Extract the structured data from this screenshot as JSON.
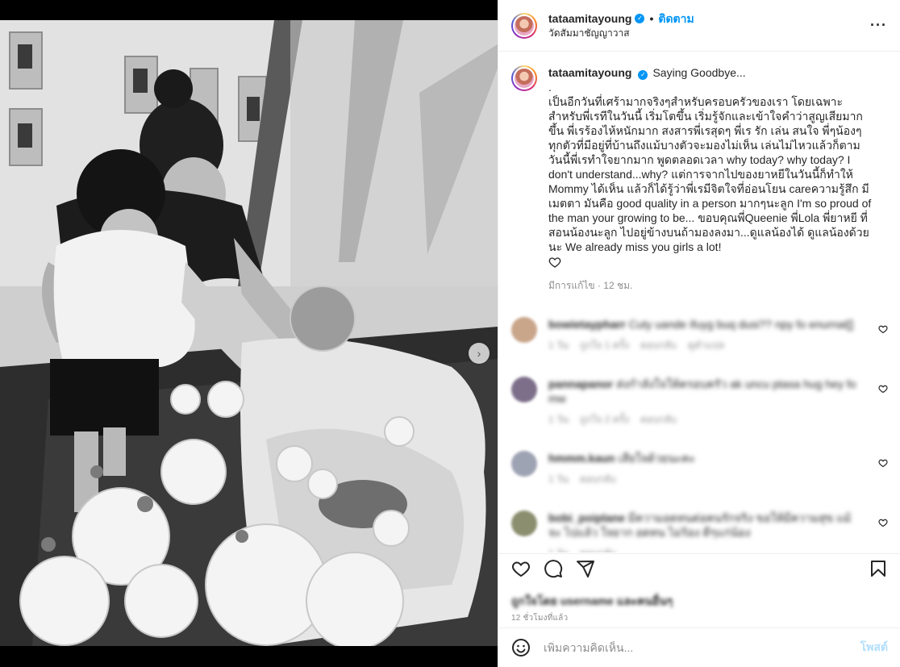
{
  "post": {
    "username": "tataamitayoung",
    "verified_icon": "verified-badge-icon",
    "separator": "•",
    "follow_label": "ติดตาม",
    "location": "วัดสัมมาชัญญาวาส",
    "more_icon": "more-options-icon",
    "more_glyph": "···"
  },
  "caption": {
    "username": "tataamitayoung",
    "text": "Saying Goodbye...\n.\nเป็นอีกวันที่เศร้ามากจริงๆสำหรับครอบครัวของเรา โดยเฉพาะสำหรับพี่เรทีในวันนี้ เริ่มโตขึ้น เริ่มรู้จักและเข้าใจคำว่าสูญเสียมากขึ้น พี่เรร้องไห้หนักมาก สงสารพี่เรสุดๆ พี่เร รัก เล่น สนใจ พี่ๆน้องๆทุกตัวที่มีอยู่ที่บ้านถึงแม้บางตัวจะมองไม่เห็น เล่นไม่ไหวแล้วก็ตาม วันนี้พี่เรทำใจยากมาก พูดตลอดเวลา why today? why today? I don't understand...why? แต่การจากไปของยาหยีในวันนี้ก็ทำให้ Mommy ได้เห็น แล้วก็ได้รู้ว่าพี่เรมีจิตใจที่อ่อนโยน careความรู้สึก มีเมตตา มันคือ good quality in a person มากๆนะลูก I'm so proud of the man your growing to be... ขอบคุณพี่Queenie พี่Lola พี่ยาหยี ที่สอนน้องนะลูก ไปอยู่ข้างบนถ้ามองลงมา...ดูแลน้องได้ ดูแลน้องด้วยนะ We already miss you girls a lot!",
    "heart_icon": "heart-outline-icon",
    "edited_label": "มีการแก้ไข",
    "separator": "·",
    "age": "12 ชม."
  },
  "comments": [
    {
      "username": "bowietaypharr",
      "text": "Cuty uande ifuyg buq dusi?? npy fo enurnat[]",
      "sub": [
        "1 วัน",
        "ถูกใจ 1 ครั้ง",
        "ตอบกลับ",
        "ดูคำแปล"
      ],
      "avatar_color": "#c9a58a"
    },
    {
      "username": "pannapanor",
      "text": "ส่งกำลังใจให้ครอบครัว ak uncu ptasa hug hey fo mw",
      "sub": [
        "1 วัน",
        "ถูกใจ 2 ครั้ง",
        "ตอบกลับ"
      ],
      "avatar_color": "#7d6f8a"
    },
    {
      "username": "hmmm.kaun",
      "text": "เสียใจด้วยนะคะ",
      "sub": [
        "1 วัน",
        "ตอบกลับ"
      ],
      "avatar_color": "#9ea3b3"
    },
    {
      "username": "bobi_poiplane",
      "text": "มีความอดทนต่อคนรักจริง ขอให้มีความสุข แม้จะ ไปแล้ว ใจยาก อดทน ไม่ร้อง ดีๆแก่น้อง",
      "sub": [
        "1 วัน",
        "ตอบกลับ"
      ],
      "avatar_color": "#8b8f6f"
    }
  ],
  "actions": {
    "like_icon": "heart-outline-icon",
    "comment_icon": "comment-bubble-icon",
    "share_icon": "paper-plane-share-icon",
    "save_icon": "bookmark-icon",
    "likes_text": "ถูกใจโดย username และคนอื่นๆ",
    "time": "12 ชั่วโมงที่แล้ว"
  },
  "add_comment": {
    "emoji_icon": "emoji-smiley-icon",
    "placeholder": "เพิ่มความคิดเห็น...",
    "post_label": "โพสต์"
  },
  "media": {
    "next_icon": "chevron-right-icon",
    "next_glyph": "›"
  }
}
